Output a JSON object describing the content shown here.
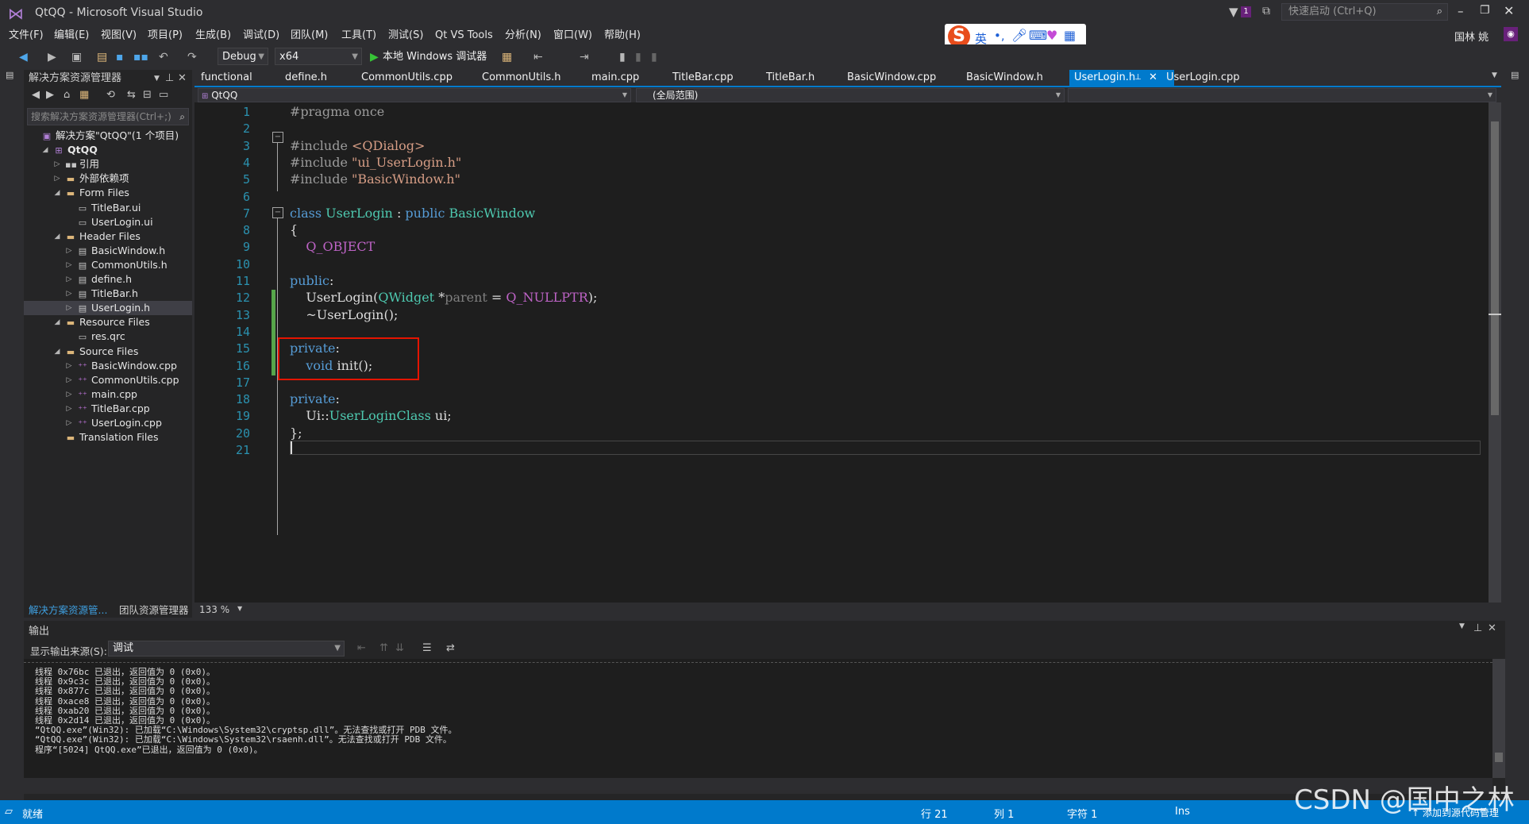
{
  "window": {
    "title": "QtQQ - Microsoft Visual Studio"
  },
  "titlebar": {
    "quick_launch_placeholder": "快速启动 (Ctrl+Q)",
    "notification_count": "1",
    "user": "国林 姚"
  },
  "menu": [
    "文件(F)",
    "编辑(E)",
    "视图(V)",
    "项目(P)",
    "生成(B)",
    "调试(D)",
    "团队(M)",
    "工具(T)",
    "测试(S)",
    "Qt VS Tools",
    "分析(N)",
    "窗口(W)",
    "帮助(H)"
  ],
  "toolbar": {
    "config": "Debug",
    "platform": "x64",
    "run_label": "本地 Windows 调试器"
  },
  "ime": {
    "lang_label": "英"
  },
  "solution_explorer": {
    "title": "解决方案资源管理器",
    "search_placeholder": "搜索解决方案资源管理器(Ctrl+;)",
    "tree": [
      {
        "label": "解决方案\"QtQQ\"(1 个项目)",
        "level": 0,
        "expander": "",
        "icon": "solution-icon",
        "bold": false,
        "selected": false
      },
      {
        "label": "QtQQ",
        "level": 1,
        "expander": "expanded",
        "icon": "project-icon",
        "bold": true,
        "selected": false
      },
      {
        "label": "引用",
        "level": 2,
        "expander": "collapsed",
        "icon": "references-icon",
        "bold": false,
        "selected": false
      },
      {
        "label": "外部依赖项",
        "level": 2,
        "expander": "collapsed",
        "icon": "folder-icon",
        "bold": false,
        "selected": false
      },
      {
        "label": "Form Files",
        "level": 2,
        "expander": "expanded",
        "icon": "folder-icon",
        "bold": false,
        "selected": false
      },
      {
        "label": "TitleBar.ui",
        "level": 3,
        "expander": "",
        "icon": "file-icon",
        "bold": false,
        "selected": false
      },
      {
        "label": "UserLogin.ui",
        "level": 3,
        "expander": "",
        "icon": "file-icon",
        "bold": false,
        "selected": false
      },
      {
        "label": "Header Files",
        "level": 2,
        "expander": "expanded",
        "icon": "folder-icon",
        "bold": false,
        "selected": false
      },
      {
        "label": "BasicWindow.h",
        "level": 3,
        "expander": "collapsed",
        "icon": "header-file-icon",
        "bold": false,
        "selected": false
      },
      {
        "label": "CommonUtils.h",
        "level": 3,
        "expander": "collapsed",
        "icon": "header-file-icon",
        "bold": false,
        "selected": false
      },
      {
        "label": "define.h",
        "level": 3,
        "expander": "collapsed",
        "icon": "header-file-icon",
        "bold": false,
        "selected": false
      },
      {
        "label": "TitleBar.h",
        "level": 3,
        "expander": "collapsed",
        "icon": "header-file-icon",
        "bold": false,
        "selected": false
      },
      {
        "label": "UserLogin.h",
        "level": 3,
        "expander": "collapsed",
        "icon": "header-file-icon",
        "bold": false,
        "selected": true
      },
      {
        "label": "Resource Files",
        "level": 2,
        "expander": "expanded",
        "icon": "folder-icon",
        "bold": false,
        "selected": false
      },
      {
        "label": "res.qrc",
        "level": 3,
        "expander": "",
        "icon": "file-icon",
        "bold": false,
        "selected": false
      },
      {
        "label": "Source Files",
        "level": 2,
        "expander": "expanded",
        "icon": "folder-icon",
        "bold": false,
        "selected": false
      },
      {
        "label": "BasicWindow.cpp",
        "level": 3,
        "expander": "collapsed",
        "icon": "cpp-file-icon",
        "bold": false,
        "selected": false
      },
      {
        "label": "CommonUtils.cpp",
        "level": 3,
        "expander": "collapsed",
        "icon": "cpp-file-icon",
        "bold": false,
        "selected": false
      },
      {
        "label": "main.cpp",
        "level": 3,
        "expander": "collapsed",
        "icon": "cpp-file-icon",
        "bold": false,
        "selected": false
      },
      {
        "label": "TitleBar.cpp",
        "level": 3,
        "expander": "collapsed",
        "icon": "cpp-file-icon",
        "bold": false,
        "selected": false
      },
      {
        "label": "UserLogin.cpp",
        "level": 3,
        "expander": "collapsed",
        "icon": "cpp-file-icon",
        "bold": false,
        "selected": false
      },
      {
        "label": "Translation Files",
        "level": 2,
        "expander": "",
        "icon": "folder-icon",
        "bold": false,
        "selected": false
      }
    ],
    "bottom_tabs": [
      "解决方案资源管...",
      "团队资源管理器"
    ]
  },
  "editor": {
    "tabs": [
      "functional",
      "define.h",
      "CommonUtils.cpp",
      "CommonUtils.h",
      "main.cpp",
      "TitleBar.cpp",
      "TitleBar.h",
      "BasicWindow.cpp",
      "BasicWindow.h",
      "UserLogin.h",
      "UserLogin.cpp"
    ],
    "active_tab": "UserLogin.h",
    "nav_project": "QtQQ",
    "nav_scope": "(全局范围)",
    "zoom": "133 %",
    "lines": [
      [
        [
          "pp",
          "#pragma once"
        ]
      ],
      [],
      [
        [
          "pp",
          "#include "
        ],
        [
          "st",
          "<QDialog>"
        ]
      ],
      [
        [
          "pp",
          "#include "
        ],
        [
          "st",
          "\"ui_UserLogin.h\""
        ]
      ],
      [
        [
          "pp",
          "#include "
        ],
        [
          "st",
          "\"BasicWindow.h\""
        ]
      ],
      [],
      [
        [
          "kw",
          "class "
        ],
        [
          "ty",
          "UserLogin"
        ],
        [
          "tx",
          " : "
        ],
        [
          "kw",
          "public "
        ],
        [
          "ty",
          "BasicWindow"
        ]
      ],
      [
        [
          "tx",
          "{"
        ]
      ],
      [
        [
          "tx",
          "    "
        ],
        [
          "mc",
          "Q_OBJECT"
        ]
      ],
      [],
      [
        [
          "kw",
          "public"
        ],
        [
          "tx",
          ":"
        ]
      ],
      [
        [
          "tx",
          "    UserLogin("
        ],
        [
          "ty",
          "QWidget"
        ],
        [
          "tx",
          " *"
        ],
        [
          "pm",
          "parent"
        ],
        [
          "tx",
          " = "
        ],
        [
          "mc",
          "Q_NULLPTR"
        ],
        [
          "tx",
          ");"
        ]
      ],
      [
        [
          "tx",
          "    ~UserLogin();"
        ]
      ],
      [],
      [
        [
          "kw",
          "private"
        ],
        [
          "tx",
          ":"
        ]
      ],
      [
        [
          "tx",
          "    "
        ],
        [
          "kw",
          "void"
        ],
        [
          "tx",
          " init();"
        ]
      ],
      [],
      [
        [
          "kw",
          "private"
        ],
        [
          "tx",
          ":"
        ]
      ],
      [
        [
          "tx",
          "    Ui::"
        ],
        [
          "ty",
          "UserLoginClass"
        ],
        [
          "tx",
          " ui;"
        ]
      ],
      [
        [
          "tx",
          "};"
        ]
      ],
      []
    ]
  },
  "output": {
    "title": "输出",
    "source_label": "显示输出来源(S):",
    "source_value": "调试",
    "lines": [
      "线程 0x76bc 已退出，返回值为 0 (0x0)。",
      "线程 0x9c3c 已退出，返回值为 0 (0x0)。",
      "线程 0x877c 已退出，返回值为 0 (0x0)。",
      "线程 0xace8 已退出，返回值为 0 (0x0)。",
      "线程 0xab20 已退出，返回值为 0 (0x0)。",
      "线程 0x2d14 已退出，返回值为 0 (0x0)。",
      "“QtQQ.exe”(Win32): 已加载“C:\\Windows\\System32\\cryptsp.dll”。无法查找或打开 PDB 文件。",
      "“QtQQ.exe”(Win32): 已加载“C:\\Windows\\System32\\rsaenh.dll”。无法查找或打开 PDB 文件。",
      "程序“[5024] QtQQ.exe”已退出，返回值为 0 (0x0)。"
    ]
  },
  "statusbar": {
    "ready": "就绪",
    "row": "行 21",
    "col": "列 1",
    "char": "字符 1",
    "ins": "Ins",
    "add_source": "↑ 添加到源代码管理"
  },
  "watermark": "CSDN @国中之林",
  "colors": {
    "accent": "#007acc",
    "highlight_box": "#e51400",
    "background": "#1e1e1e"
  }
}
